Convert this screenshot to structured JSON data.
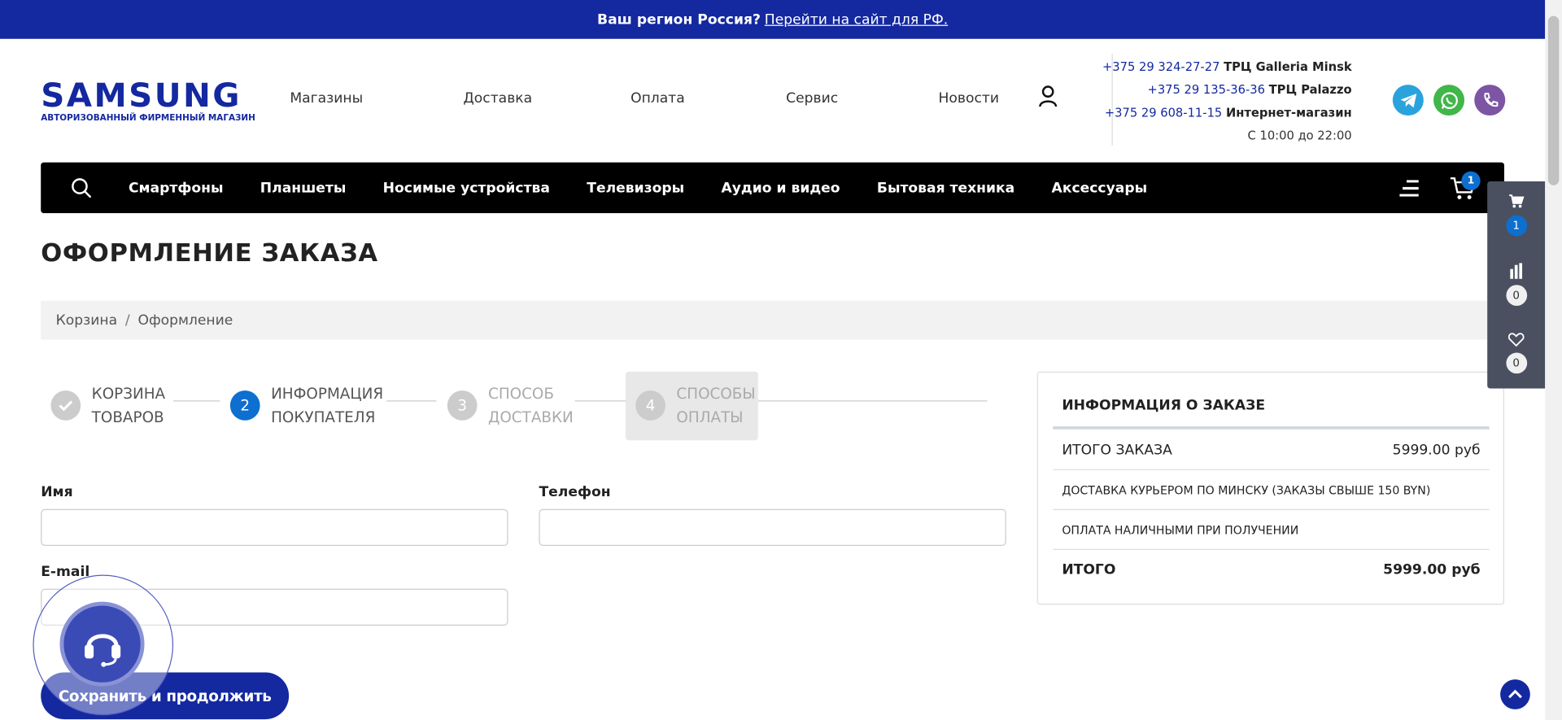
{
  "topbar": {
    "text": "Ваш регион Россия?",
    "link": "Перейти на сайт для РФ."
  },
  "logo": {
    "brand": "SAMSUNG",
    "subtitle": "АВТОРИЗОВАННЫЙ ФИРМЕННЫЙ МАГАЗИН"
  },
  "nav": {
    "items": [
      "Магазины",
      "Доставка",
      "Оплата",
      "Сервис",
      "Новости"
    ]
  },
  "contacts": {
    "lines": [
      {
        "phone": "+375 29 324-27-27",
        "place": "ТРЦ Galleria Minsk"
      },
      {
        "phone": "+375 29 135-36-36",
        "place": "ТРЦ Palazzo"
      },
      {
        "phone": "+375 29 608-11-15",
        "place": "Интернет-магазин"
      }
    ],
    "hours": "С 10:00 до 22:00"
  },
  "social": [
    "telegram-icon",
    "whatsapp-icon",
    "viber-icon"
  ],
  "categories": [
    "Смартфоны",
    "Планшеты",
    "Носимые устройства",
    "Телевизоры",
    "Аудио и видео",
    "Бытовая техника",
    "Аксессуары"
  ],
  "cart_count": "1",
  "page_title": "ОФОРМЛЕНИЕ ЗАКАЗА",
  "breadcrumb": {
    "items": [
      "Корзина",
      "Оформление"
    ],
    "separator": "/"
  },
  "steps": [
    {
      "num": "",
      "line1": "КОРЗИНА",
      "line2": "ТОВАРОВ",
      "state": "done"
    },
    {
      "num": "2",
      "line1": "ИНФОРМАЦИЯ",
      "line2": "ПОКУПАТЕЛЯ",
      "state": "active"
    },
    {
      "num": "3",
      "line1": "СПОСОБ",
      "line2": "ДОСТАВКИ",
      "state": "pending"
    },
    {
      "num": "4",
      "line1": "СПОСОБЫ",
      "line2": "ОПЛАТЫ",
      "state": "pending"
    }
  ],
  "form": {
    "name_label": "Имя",
    "name_value": "",
    "phone_label": "Телефон",
    "phone_value": "",
    "email_label": "E-mail",
    "email_value": "",
    "submit": "Сохранить и продолжить"
  },
  "order": {
    "heading": "ИНФОРМАЦИЯ О ЗАКАЗЕ",
    "subtotal_label": "ИТОГО ЗАКАЗА",
    "subtotal_value": "5999.00 руб",
    "delivery": "ДОСТАВКА КУРЬЕРОМ ПО МИНСКУ (ЗАКАЗЫ СВЫШЕ 150 BYN)",
    "payment": "ОПЛАТА НАЛИЧНЫМИ ПРИ ПОЛУЧЕНИИ",
    "total_label": "ИТОГО",
    "total_value": "5999.00 руб"
  },
  "side_widget": {
    "cart": "1",
    "compare": "0",
    "wishlist": "0"
  },
  "colors": {
    "brand": "#1428a0",
    "accent": "#0d6fcf"
  }
}
